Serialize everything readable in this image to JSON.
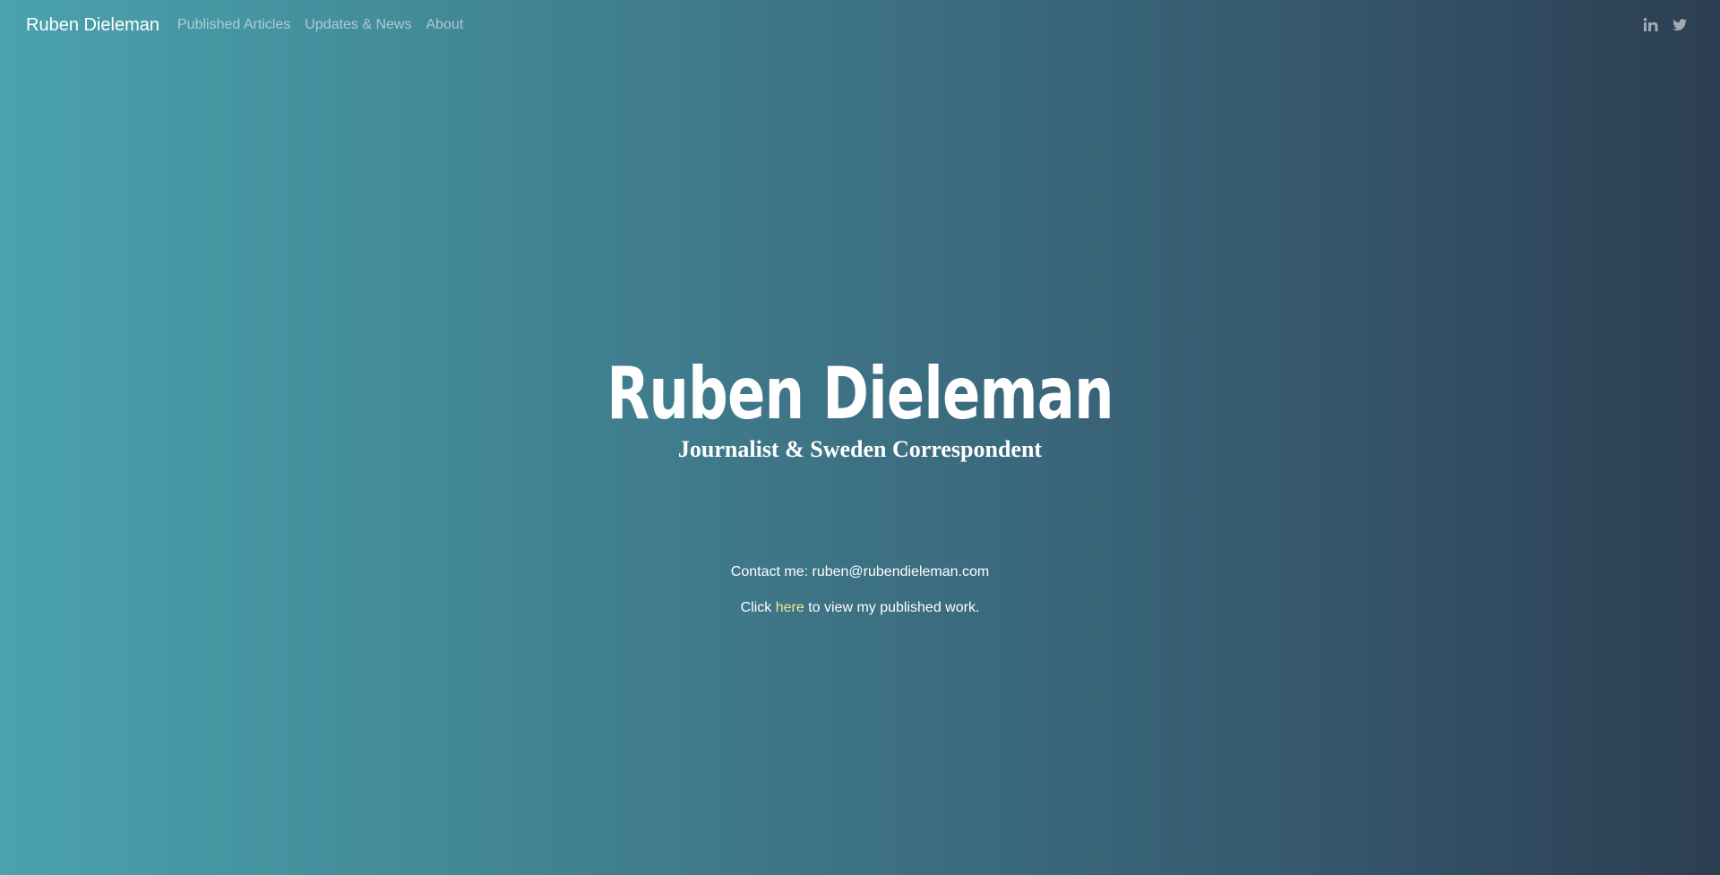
{
  "navbar": {
    "brand": "Ruben Dieleman",
    "links": [
      {
        "label": "Published Articles"
      },
      {
        "label": "Updates & News"
      },
      {
        "label": "About"
      }
    ],
    "social": [
      {
        "icon": "linkedin-icon",
        "label": "in"
      },
      {
        "icon": "twitter-icon"
      }
    ]
  },
  "hero": {
    "title": "Ruben Dieleman",
    "subtitle": "Journalist & Sweden Correspondent"
  },
  "contact": {
    "line1": "Contact me: ruben@rubendieleman.com",
    "line2_prefix": "Click ",
    "line2_link": "here",
    "line2_suffix": " to view my published work."
  },
  "colors": {
    "gradient_start": "#4aa2ad",
    "gradient_end": "#2c3e52",
    "link_accent": "#f6e58d"
  }
}
